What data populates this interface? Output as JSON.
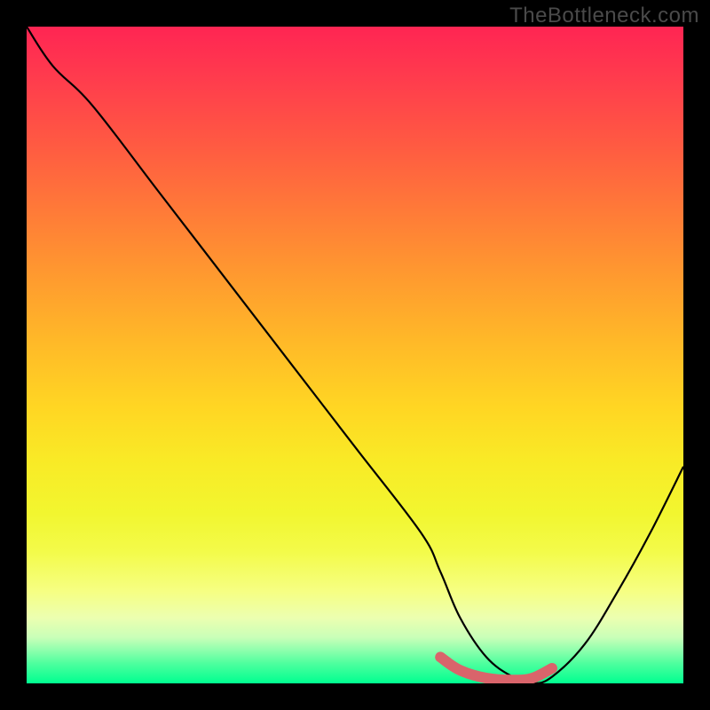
{
  "watermark": "TheBottleneck.com",
  "chart_data": {
    "type": "line",
    "title": "",
    "xlabel": "",
    "ylabel": "",
    "xlim": [
      0,
      100
    ],
    "ylim": [
      0,
      100
    ],
    "series": [
      {
        "name": "bottleneck-curve",
        "x": [
          0,
          4,
          10,
          20,
          30,
          40,
          50,
          60,
          63,
          66,
          70,
          74,
          77,
          80,
          85,
          90,
          95,
          100
        ],
        "values": [
          100,
          94,
          88,
          75,
          62,
          49,
          36,
          23,
          17,
          10,
          4,
          1,
          0,
          1,
          6,
          14,
          23,
          33
        ]
      }
    ],
    "highlight_segment": {
      "name": "optimal-range",
      "x": [
        63,
        66,
        70,
        74,
        77,
        80
      ],
      "values": [
        4.0,
        2.0,
        0.8,
        0.5,
        0.8,
        2.3
      ],
      "color": "#d9646b"
    },
    "gradient_stops": [
      {
        "pos": 0.0,
        "color": "#ff2553"
      },
      {
        "pos": 0.5,
        "color": "#ffc425"
      },
      {
        "pos": 0.8,
        "color": "#f4ff50"
      },
      {
        "pos": 1.0,
        "color": "#00ff90"
      }
    ]
  }
}
